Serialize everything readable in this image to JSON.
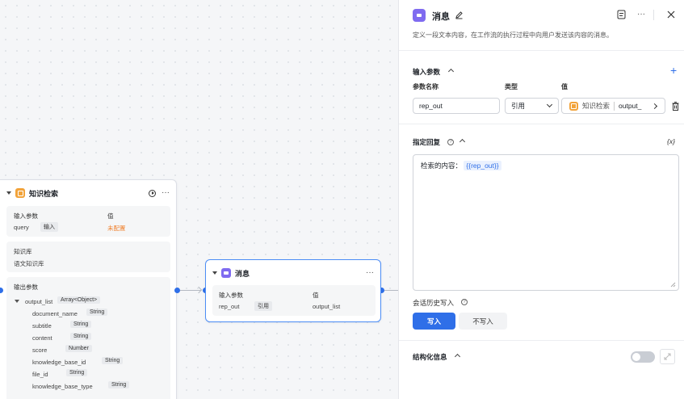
{
  "canvas": {
    "kb_node": {
      "title": "知识检索",
      "input_params_label": "输入参数",
      "value_label": "值",
      "input_row": {
        "name": "query",
        "type": "输入",
        "value": "未配置"
      },
      "kb_label": "知识库",
      "kb_value": "语文知识库",
      "output_params_label": "输出参数",
      "output_list": {
        "name": "output_list",
        "type": "Array<Object>"
      },
      "output_fields": [
        {
          "name": "document_name",
          "type": "String"
        },
        {
          "name": "subtitle",
          "type": "String"
        },
        {
          "name": "content",
          "type": "String"
        },
        {
          "name": "score",
          "type": "Number"
        },
        {
          "name": "knowledge_base_id",
          "type": "String"
        },
        {
          "name": "file_id",
          "type": "String"
        },
        {
          "name": "knowledge_base_type",
          "type": "String"
        }
      ]
    },
    "msg_node": {
      "title": "消息",
      "input_params_label": "输入参数",
      "value_label": "值",
      "row": {
        "name": "rep_out",
        "type": "引用",
        "value": "output_list"
      }
    }
  },
  "panel": {
    "title": "消息",
    "description": "定义一段文本内容，在工作流的执行过程中向用户发送该内容的消息。",
    "input_section": {
      "title": "输入参数",
      "col_name": "参数名称",
      "col_type": "类型",
      "col_value": "值",
      "row": {
        "name": "rep_out",
        "type": "引用",
        "ref_node": "知识检索",
        "ref_field": "output_"
      }
    },
    "reply_section": {
      "title": "指定回复",
      "var_button": "{x}",
      "content_prefix": "检索的内容：",
      "content_var": "{{rep_out}}"
    },
    "history_section": {
      "title": "会话历史写入",
      "write_label": "写入",
      "no_write_label": "不写入"
    },
    "structured_section": {
      "title": "结构化信息"
    }
  },
  "colors": {
    "accent": "#2f6fe8",
    "kb_icon": "#f2a33a",
    "msg_icon": "#7f6bf0",
    "warn": "#f07f2a"
  }
}
